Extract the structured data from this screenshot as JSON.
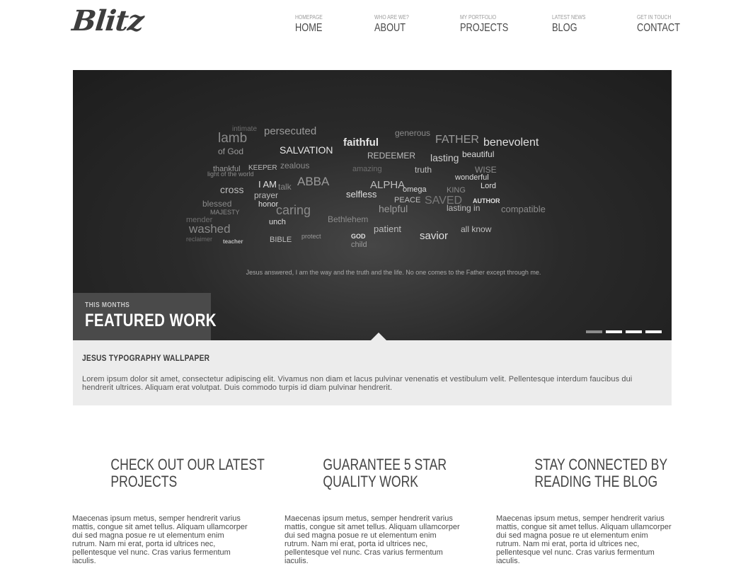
{
  "brand": {
    "logo": "Blitz"
  },
  "nav": [
    {
      "sub": "HOMEPAGE",
      "label": "HOME"
    },
    {
      "sub": "WHO ARE WE?",
      "label": "ABOUT"
    },
    {
      "sub": "MY PORTFOLIO",
      "label": "PROJECTS"
    },
    {
      "sub": "LATEST NEWS",
      "label": "BLOG"
    },
    {
      "sub": "GET IN TOUCH",
      "label": "CONTACT"
    }
  ],
  "slider": {
    "words": [
      "lamb",
      "intimate",
      "persecuted",
      "faithful",
      "generous",
      "FATHER",
      "benevolent",
      "of God",
      "SALVATION",
      "REDEEMER",
      "lasting",
      "beautiful",
      "thankful",
      "KEEPER",
      "zealous",
      "amazing",
      "truth",
      "WISE",
      "light of the world",
      "ABBA",
      "ALPHA",
      "omega",
      "wonderful",
      "cross",
      "I AM",
      "talk",
      "selfless",
      "KING",
      "Lord",
      "blessed",
      "prayer",
      "honor",
      "PEACE",
      "SAVED",
      "AUTHOR",
      "MAJESTY",
      "caring",
      "helpful",
      "lasting in",
      "compatible",
      "mender",
      "washed",
      "unch",
      "Bethlehem",
      "patient",
      "all know",
      "reclaimer",
      "teacher",
      "BIBLE",
      "protect",
      "GOD",
      "child",
      "savior"
    ],
    "quote": "Jesus answered,    I am the way and the truth and the life. No one comes to the Father except through me.",
    "featured_sub": "THIS MONTHS",
    "featured_title": "FEATURED WORK",
    "active_dot": 0,
    "dot_count": 4
  },
  "caption": {
    "title": "JESUS TYPOGRAPHY WALLPAPER",
    "text": "Lorem ipsum dolor sit amet, consectetur adipiscing elit. Vivamus non diam et lacus pulvinar venenatis et vestibulum velit. Pellentesque interdum faucibus dui hendrerit ultrices. Aliquam erat volutpat. Duis commodo turpis id diam pulvinar hendrerit."
  },
  "columns": [
    {
      "title_line1": "CHECK OUT OUR LATEST",
      "title_line2": "PROJECTS",
      "text": "Maecenas ipsum metus, semper hendrerit varius mattis, congue sit amet tellus. Aliquam ullamcorper dui sed magna posue re ut elementum enim rutrum. Nam mi erat, porta id ultrices nec, pellentesque vel nunc. Cras varius fermentum iaculis."
    },
    {
      "title_line1": "GUARANTEE 5 STAR",
      "title_line2": "QUALITY WORK",
      "text": "Maecenas ipsum metus, semper hendrerit varius mattis, congue sit amet tellus. Aliquam ullamcorper dui sed magna posue re ut elementum enim rutrum. Nam mi erat, porta id ultrices nec, pellentesque vel nunc. Cras varius fermentum iaculis."
    },
    {
      "title_line1": "STAY CONNECTED BY",
      "title_line2": "READING THE BLOG",
      "text": "Maecenas ipsum metus, semper hendrerit varius mattis, congue sit amet tellus. Aliquam ullamcorper dui sed magna posue re ut elementum enim rutrum. Nam mi erat, porta id ultrices nec, pellentesque vel nunc. Cras varius fermentum iaculis."
    }
  ]
}
